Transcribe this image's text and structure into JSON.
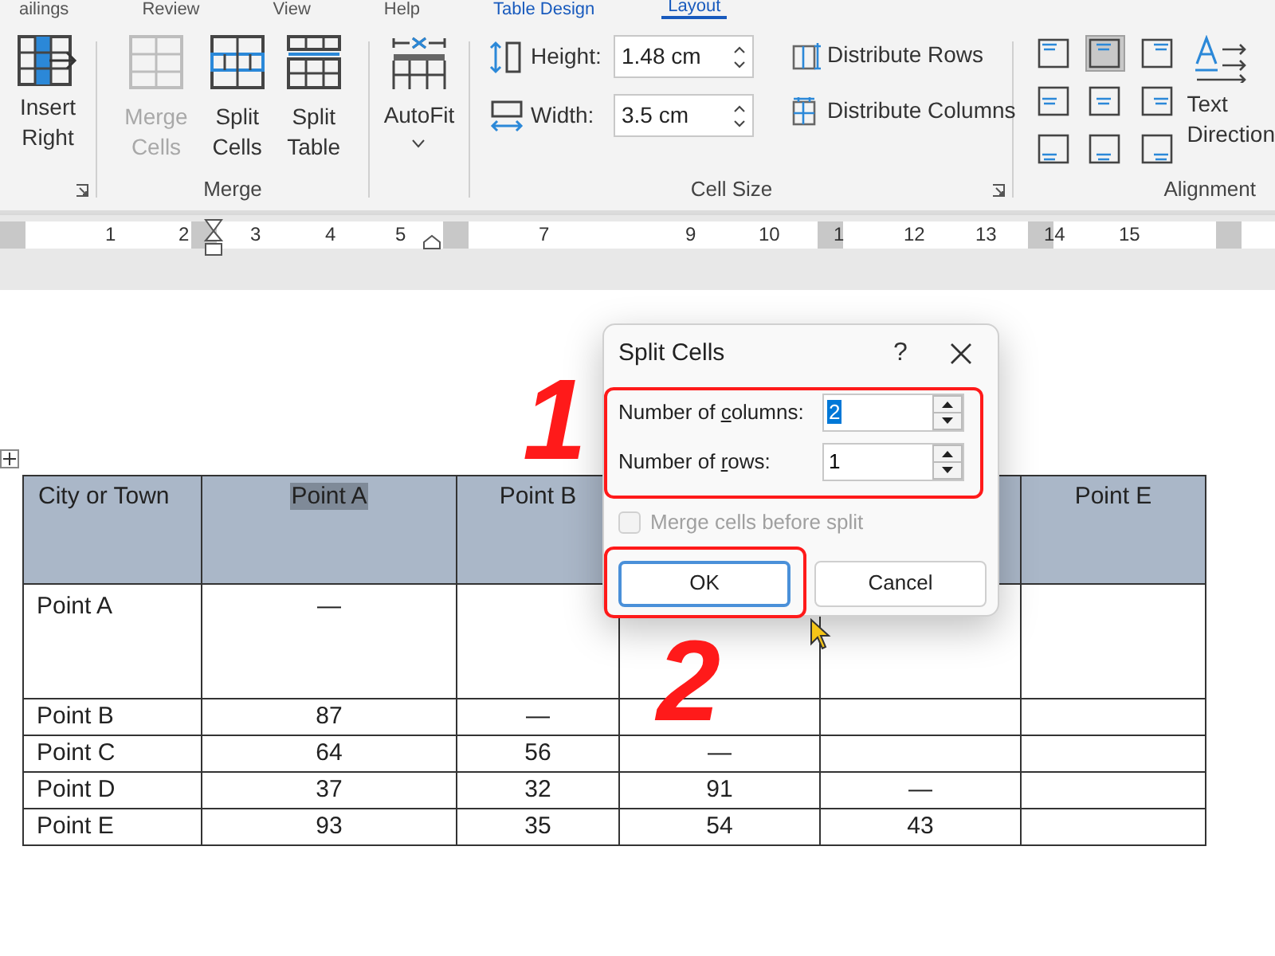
{
  "ribbon_tabs": [
    {
      "label": "ailings",
      "selected": false
    },
    {
      "label": "Review",
      "selected": false
    },
    {
      "label": "View",
      "selected": false
    },
    {
      "label": "Help",
      "selected": false
    },
    {
      "label": "Table Design",
      "selected": false
    },
    {
      "label": "Layout",
      "selected": true
    }
  ],
  "insert_right": {
    "lines": [
      "Insert",
      "Right"
    ]
  },
  "merge_group": {
    "label": "Merge",
    "buttons": [
      {
        "kind": "merge",
        "lines": [
          "Merge",
          "Cells"
        ],
        "disabled": true
      },
      {
        "kind": "split_cells",
        "lines": [
          "Split",
          "Cells"
        ],
        "disabled": false
      },
      {
        "kind": "split_table",
        "lines": [
          "Split",
          "Table"
        ],
        "disabled": false
      }
    ]
  },
  "autofit": {
    "label": "AutoFit"
  },
  "cell_size": {
    "label": "Cell Size",
    "fields": [
      {
        "kind": "height",
        "label": "Height:",
        "value": "1.48 cm"
      },
      {
        "kind": "width",
        "label": "Width:",
        "value": "3.5 cm"
      }
    ],
    "distribute": [
      {
        "kind": "rows",
        "label": "Distribute Rows"
      },
      {
        "kind": "columns",
        "label": "Distribute Columns"
      }
    ]
  },
  "alignment": {
    "label": "Alignment",
    "cells": [
      {
        "selected": false
      },
      {
        "selected": true
      },
      {
        "selected": false
      },
      {
        "selected": false
      },
      {
        "selected": false
      },
      {
        "selected": false
      },
      {
        "selected": false
      },
      {
        "selected": false
      },
      {
        "selected": false
      }
    ],
    "text_direction": [
      "Text",
      "Direction"
    ]
  },
  "ruler": {
    "numbers": [
      "1",
      "2",
      "3",
      "4",
      "5",
      "7",
      "9",
      "10",
      "1",
      "12",
      "13",
      "14",
      "15"
    ]
  },
  "table": {
    "header": [
      {
        "text": "City or Town",
        "selected": false
      },
      {
        "text": "Point A",
        "selected": true
      },
      {
        "text": "Point B",
        "selected": false
      },
      {
        "text": "Point E",
        "selected": false
      }
    ],
    "rows": [
      [
        {
          "text": "Point A"
        },
        {
          "text": "—"
        },
        {},
        {},
        {},
        {}
      ],
      [
        {
          "text": "Point B"
        },
        {
          "text": "87"
        },
        {
          "text": "—"
        },
        {},
        {},
        {}
      ],
      [
        {
          "text": "Point C"
        },
        {
          "text": "64"
        },
        {
          "text": "56"
        },
        {
          "text": "—"
        },
        {},
        {}
      ],
      [
        {
          "text": "Point D"
        },
        {
          "text": "37"
        },
        {
          "text": "32"
        },
        {
          "text": "91"
        },
        {
          "text": "—"
        },
        {}
      ],
      [
        {
          "text": "Point E"
        },
        {
          "text": "93"
        },
        {
          "text": "35"
        },
        {
          "text": "54"
        },
        {
          "text": "43"
        },
        {}
      ]
    ]
  },
  "dialog": {
    "title": "Split Cells",
    "help": "?",
    "fields": [
      {
        "before": "Number of ",
        "key": "c",
        "after": "olumns:",
        "value": "2",
        "selected": true
      },
      {
        "before": "Number of ",
        "key": "r",
        "after": "ows:",
        "value": "1",
        "selected": false
      }
    ],
    "checkbox": {
      "label": "Merge cells before split",
      "checked": false,
      "disabled": true
    },
    "buttons": [
      {
        "label": "OK",
        "default": true
      },
      {
        "label": "Cancel",
        "default": false
      }
    ]
  },
  "annotations": [
    "1",
    "2"
  ]
}
